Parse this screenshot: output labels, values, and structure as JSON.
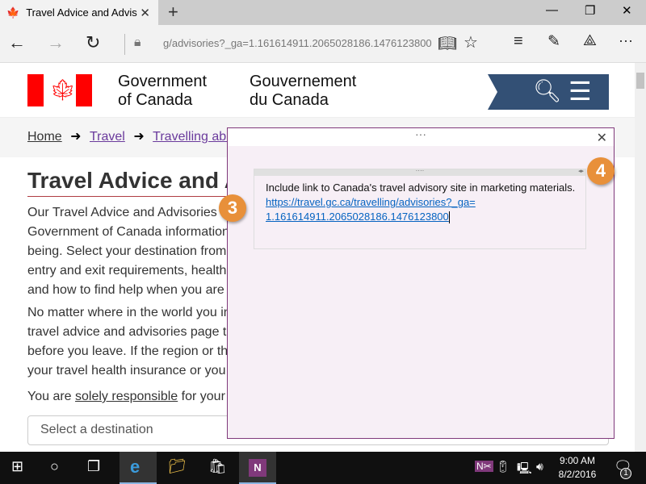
{
  "browser": {
    "tab_title": "Travel Advice and Advis",
    "url": "g/advisories?_ga=1.161614911.2065028186.1476123800"
  },
  "header": {
    "gov_en_1": "Government",
    "gov_en_2": "of Canada",
    "gov_fr_1": "Gouvernement",
    "gov_fr_2": "du Canada"
  },
  "breadcrumb": [
    "Home",
    "Travel",
    "Travelling abroad"
  ],
  "main": {
    "title": "Travel Advice and Advisories",
    "para1": [
      "Our Travel Advice and Advisories",
      "Government of Canada information",
      "being. Select your destination from",
      "entry and exit requirements, health",
      "and how to find help when you are"
    ],
    "para2": [
      "No matter where in the world you intend",
      "travel advice and advisories page t",
      "before you leave. If the region or th",
      "your travel health insurance or you"
    ],
    "para3_prefix": "You are ",
    "para3_link": "solely responsible",
    "para3_suffix": " for your",
    "select_placeholder": "Select a destination"
  },
  "note": {
    "text": "Include link to Canada's travel advisory site in marketing materials.",
    "link_line1": "https://travel.gc.ca/travelling/advisories?_ga=",
    "link_line2": "1.161614911.2065028186.1476123800"
  },
  "callouts": [
    "3",
    "4"
  ],
  "taskbar": {
    "time": "9:00 AM",
    "date": "8/2/2016",
    "notifications": "1"
  },
  "colors": {
    "accent_orange": "#e8903a",
    "popup_border": "#80397b",
    "gc_blue": "#335075",
    "flag_red": "#ff0000"
  }
}
